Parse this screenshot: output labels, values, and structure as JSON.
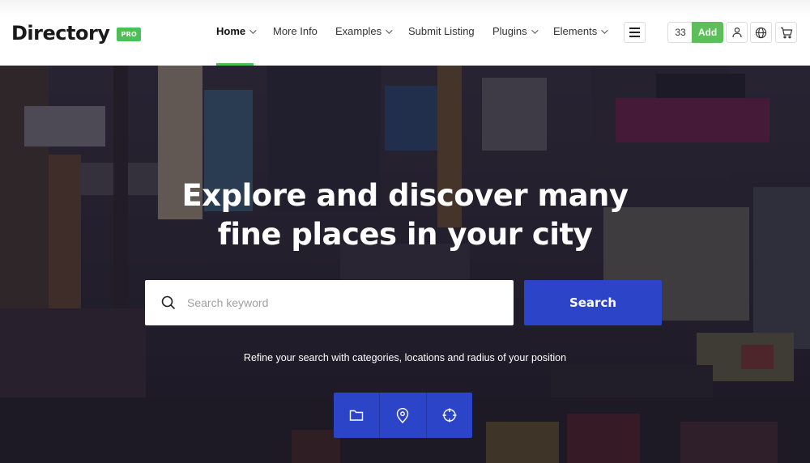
{
  "header": {
    "logo_text": "Directory",
    "logo_badge": "PRO",
    "nav": [
      {
        "label": "Home",
        "has_dropdown": true,
        "active": true
      },
      {
        "label": "More Info",
        "has_dropdown": false,
        "active": false
      },
      {
        "label": "Examples",
        "has_dropdown": true,
        "active": false
      },
      {
        "label": "Submit Listing",
        "has_dropdown": false,
        "active": false
      },
      {
        "label": "Plugins",
        "has_dropdown": true,
        "active": false
      },
      {
        "label": "Elements",
        "has_dropdown": true,
        "active": false
      }
    ],
    "menu_icon": "hamburger-icon",
    "listing_count": "33",
    "add_label": "Add",
    "action_icons": [
      "user-icon",
      "globe-icon",
      "cart-icon"
    ]
  },
  "hero": {
    "title_line1": "Explore and discover many",
    "title_line2": "fine places in your city",
    "search": {
      "placeholder": "Search keyword",
      "value": "",
      "icon": "search-icon",
      "button_label": "Search"
    },
    "refine_text": "Refine your search with categories, locations and radius of your position",
    "filters": [
      {
        "icon": "folder-icon",
        "purpose": "categories"
      },
      {
        "icon": "map-pin-icon",
        "purpose": "locations"
      },
      {
        "icon": "crosshair-icon",
        "purpose": "radius"
      }
    ],
    "background_image": "city street with billboards (Times Square)"
  },
  "colors": {
    "brand_green": "#4cbf58",
    "primary_blue": "#2c44c8",
    "text_dark": "#1a1a1a"
  }
}
